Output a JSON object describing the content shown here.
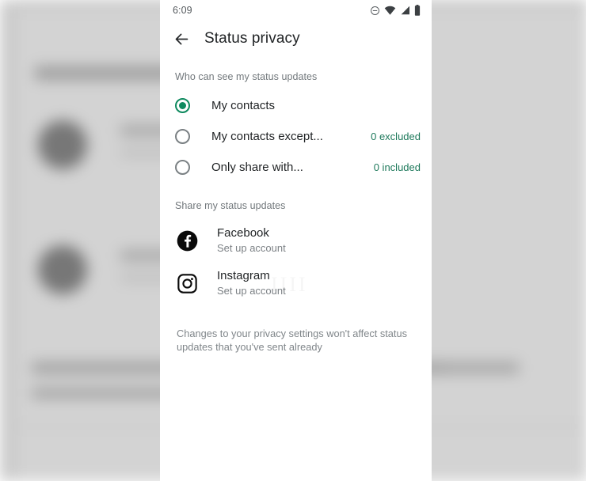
{
  "statusbar": {
    "time": "6:09",
    "icons": [
      "do-not-disturb-icon",
      "wifi-icon",
      "cellular-signal-icon",
      "battery-icon"
    ]
  },
  "appbar": {
    "back_icon": "back-arrow-icon",
    "title": "Status privacy"
  },
  "visibility_section": {
    "header": "Who can see my status updates",
    "options": [
      {
        "label": "My contacts",
        "selected": true,
        "count": ""
      },
      {
        "label": "My contacts except...",
        "selected": false,
        "count": "0 excluded"
      },
      {
        "label": "Only share with...",
        "selected": false,
        "count": "0 included"
      }
    ]
  },
  "share_section": {
    "header": "Share my status updates",
    "apps": [
      {
        "name": "Facebook",
        "status": "Set up account",
        "icon": "facebook-icon"
      },
      {
        "name": "Instagram",
        "status": "Set up account",
        "icon": "instagram-icon"
      }
    ]
  },
  "footer": {
    "note": "Changes to your privacy settings won't affect status updates that you've sent already"
  },
  "colors": {
    "accent_green": "#0f8a5f",
    "count_green": "#1f7a5c",
    "primary_text": "#1f2224",
    "secondary_text": "#7d8286",
    "sheet_bg": "#ffffff",
    "backdrop": "#d0d0d0"
  }
}
